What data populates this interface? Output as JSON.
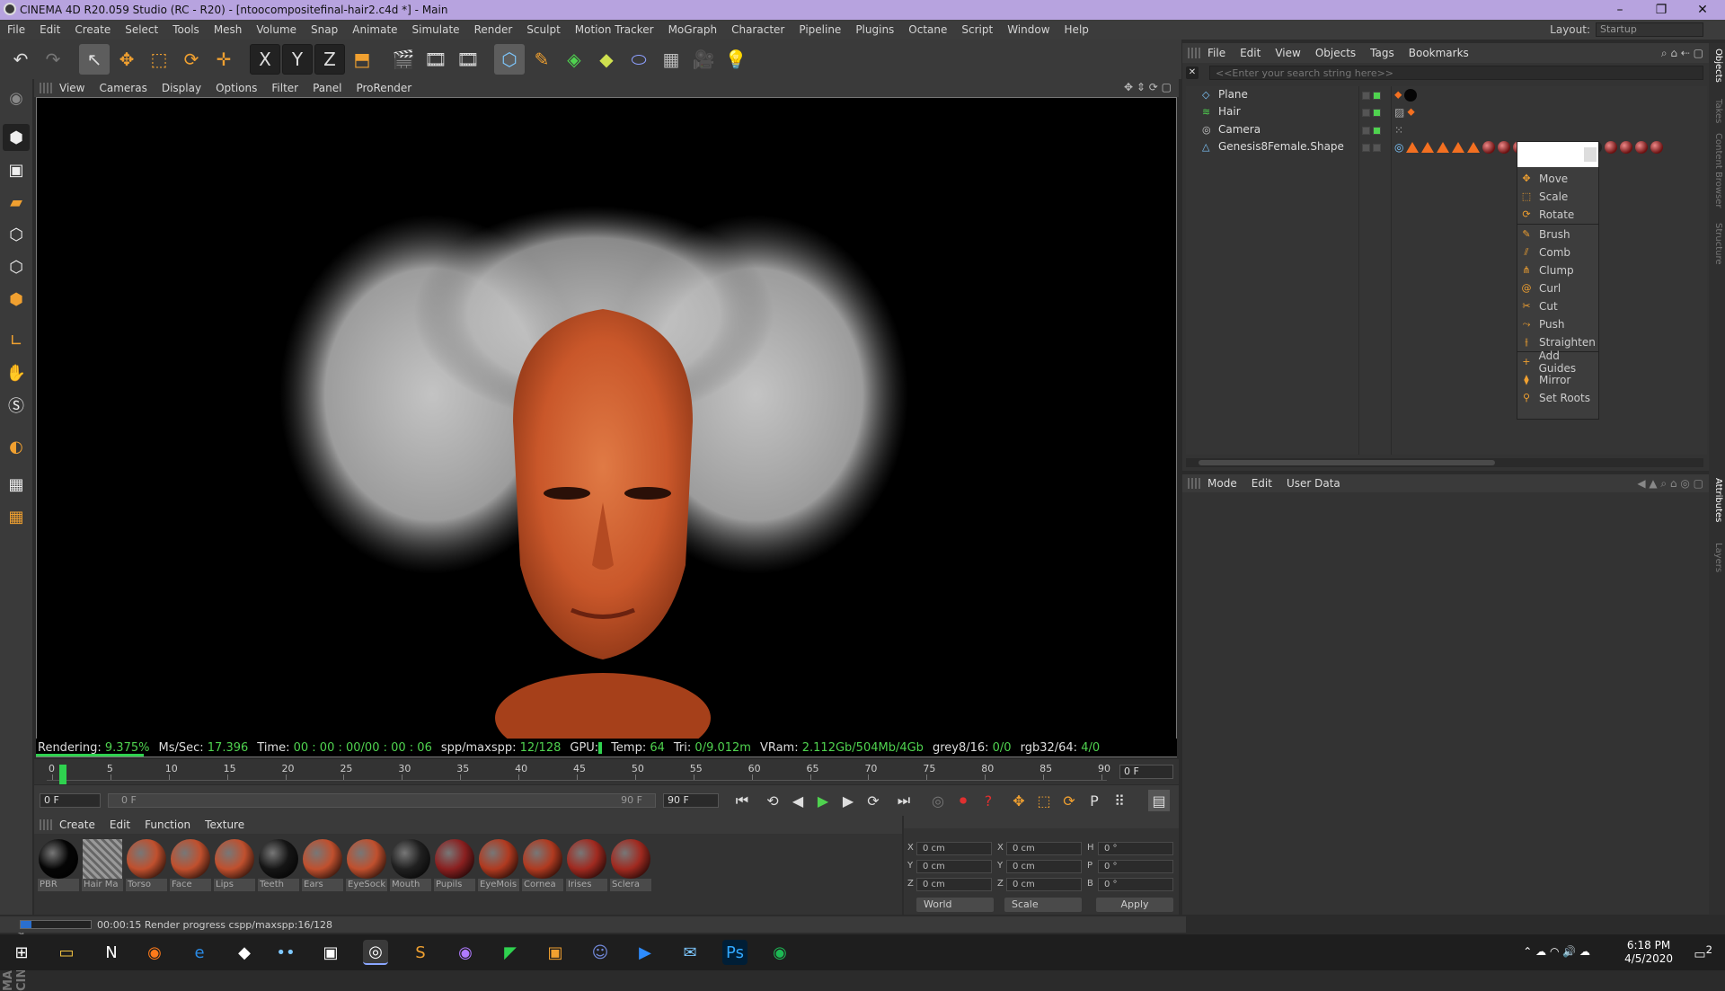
{
  "window": {
    "title": "CINEMA 4D R20.059 Studio (RC - R20) - [ntoocompositefinal-hair2.c4d *] - Main",
    "minimize": "–",
    "restore": "❐",
    "close": "✕"
  },
  "menubar": {
    "items": [
      "File",
      "Edit",
      "Create",
      "Select",
      "Tools",
      "Mesh",
      "Volume",
      "Snap",
      "Animate",
      "Simulate",
      "Render",
      "Sculpt",
      "Motion Tracker",
      "MoGraph",
      "Character",
      "Pipeline",
      "Plugins",
      "Octane",
      "Script",
      "Window",
      "Help"
    ],
    "layout_label": "Layout:",
    "layout_value": "Startup"
  },
  "toolbar": {
    "undo": "↶",
    "redo": "↷",
    "tools": [
      "↖",
      "✥",
      "⬚",
      "⟳",
      "✛"
    ],
    "axes": [
      "X",
      "Y",
      "Z"
    ],
    "coord": "⬒",
    "render": [
      "🎬",
      "🎞",
      "🎞"
    ],
    "objects": [
      "⬡",
      "✎",
      "◈",
      "◆",
      "⬭",
      "▦",
      "🎥",
      "💡"
    ]
  },
  "viewport": {
    "menu": [
      "View",
      "Cameras",
      "Display",
      "Options",
      "Filter",
      "Panel",
      "ProRender"
    ],
    "status": {
      "rendering_label": "Rendering:",
      "rendering_value": "9.375%",
      "ms_label": "Ms/Sec:",
      "ms_value": "17.396",
      "time_label": "Time:",
      "time_value": "00 : 00 : 00/00 : 00 : 06",
      "spp_label": "spp/maxspp:",
      "spp_value": "12/128",
      "gpu_label": "GPU:",
      "temp_label": "Temp:",
      "temp_value": "64",
      "tri_label": "Tri:",
      "tri_value": "0/9.012m",
      "vram_label": "VRam:",
      "vram_value": "2.112Gb/504Mb/4Gb",
      "grey_label": "grey8/16:",
      "grey_value": "0/0",
      "rgb_label": "rgb32/64:",
      "rgb_value": "4/0"
    }
  },
  "timeline": {
    "ticks": [
      "0",
      "5",
      "10",
      "15",
      "20",
      "25",
      "30",
      "35",
      "40",
      "45",
      "50",
      "55",
      "60",
      "65",
      "70",
      "75",
      "80",
      "85",
      "90"
    ],
    "current_frame": "0 F",
    "start_frame": "0 F",
    "range_start": "0 F",
    "range_end": "90 F",
    "end_frame": "90 F"
  },
  "transport": {
    "buttons": [
      "⏮",
      "⟲",
      "◀",
      "▶",
      "▶",
      "⟳",
      "⏭"
    ],
    "keys": [
      "◎",
      "⏺",
      "?",
      "✥",
      "⬚",
      "⟳",
      "P",
      "⠿",
      "▤"
    ]
  },
  "materials": {
    "menu": [
      "Create",
      "Edit",
      "Function",
      "Texture"
    ],
    "items": [
      {
        "name": "PBR",
        "color": "#050505"
      },
      {
        "name": "Hair Ma",
        "color": "#8a8a8a"
      },
      {
        "name": "Torso",
        "color": "#c0502e"
      },
      {
        "name": "Face",
        "color": "#c0502e"
      },
      {
        "name": "Lips",
        "color": "#c0502e"
      },
      {
        "name": "Teeth",
        "color": "#151515"
      },
      {
        "name": "Ears",
        "color": "#c0502e"
      },
      {
        "name": "EyeSock",
        "color": "#c0502e"
      },
      {
        "name": "Mouth",
        "color": "#202020"
      },
      {
        "name": "Pupils",
        "color": "#8a2020"
      },
      {
        "name": "EyeMois",
        "color": "#b03a20"
      },
      {
        "name": "Cornea",
        "color": "#b03a20"
      },
      {
        "name": "Irises",
        "color": "#a02a20"
      },
      {
        "name": "Sclera",
        "color": "#a02a20"
      }
    ]
  },
  "coords": {
    "x_label": "X",
    "y_label": "Y",
    "z_label": "Z",
    "h_label": "H",
    "p_label": "P",
    "b_label": "B",
    "pos": [
      "0 cm",
      "0 cm",
      "0 cm"
    ],
    "size": [
      "0 cm",
      "0 cm",
      "0 cm"
    ],
    "rot": [
      "0 °",
      "0 °",
      "0 °"
    ],
    "world": "World",
    "scale": "Scale",
    "apply": "Apply"
  },
  "bottom_status": {
    "text": "00:00:15 Render progress  cspp/maxspp:16/128",
    "progress": 0.15
  },
  "objects": {
    "menu": [
      "File",
      "Edit",
      "View",
      "Objects",
      "Tags",
      "Bookmarks"
    ],
    "search_placeholder": "<<Enter your search string here>>",
    "items": [
      {
        "name": "Plane",
        "icon": "plane-icon"
      },
      {
        "name": "Hair",
        "icon": "hair-icon"
      },
      {
        "name": "Camera",
        "icon": "camera-icon"
      },
      {
        "name": "Genesis8Female.Shape",
        "icon": "polygon-icon"
      }
    ]
  },
  "hair_tool_menu": {
    "items": [
      "Move",
      "Scale",
      "Rotate",
      "Brush",
      "Comb",
      "Clump",
      "Curl",
      "Cut",
      "Push",
      "Straighten",
      "Add Guides",
      "Mirror",
      "Set Roots"
    ]
  },
  "attributes": {
    "menu": [
      "Mode",
      "Edit",
      "User Data"
    ]
  },
  "right_rail": {
    "tabs": [
      "Objects",
      "Takes",
      "Content Browser",
      "Structure",
      "Attributes",
      "Layers"
    ]
  },
  "taskbar": {
    "time": "6:18 PM",
    "date": "4/5/2020",
    "notifications": "2"
  },
  "colors": {
    "accent_green": "#4fd24f",
    "tag_orange": "#f37021",
    "title_bar": "#b7a3df"
  }
}
